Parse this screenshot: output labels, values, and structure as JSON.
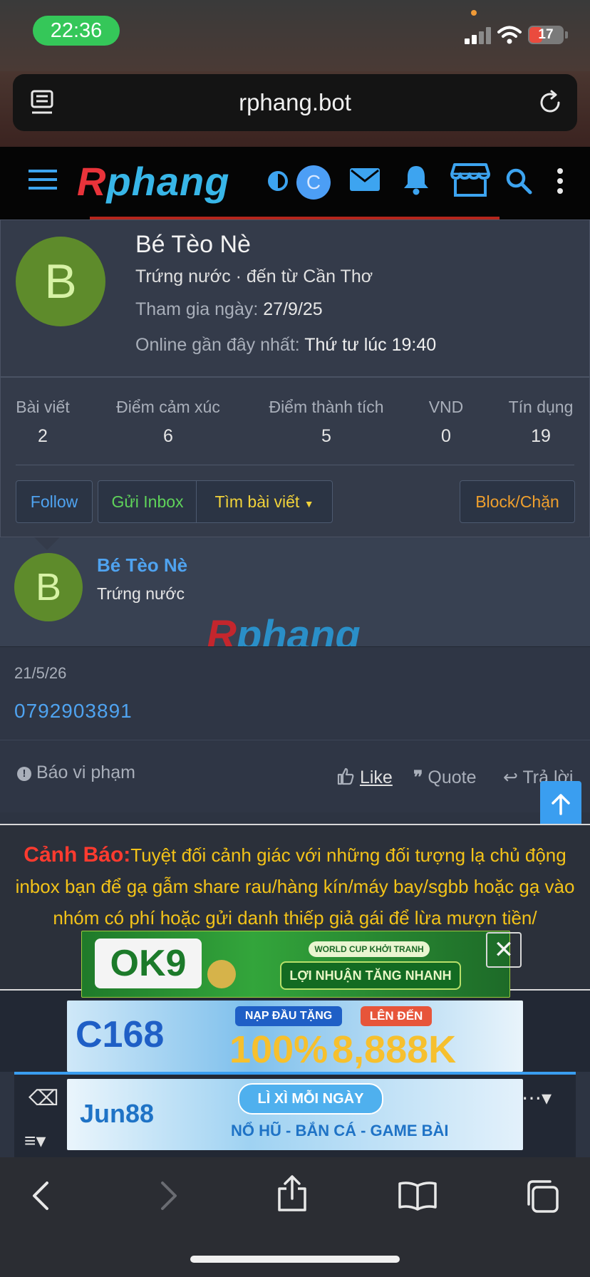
{
  "status_bar": {
    "time": "22:36",
    "battery": "17"
  },
  "browser": {
    "url": "rphang.bot"
  },
  "site": {
    "logo_r": "R",
    "logo_rest": "phang",
    "avatar_letter": "C"
  },
  "profile": {
    "avatar_letter": "B",
    "name": "Bé Tèo Nè",
    "subtitle": "Trứng nước · đến từ Cần Thơ",
    "joined_label": "Tham gia ngày:",
    "joined_value": "27/9/25",
    "online_label": "Online gần đây nhất:",
    "online_value": "Thứ tư lúc 19:40",
    "stats": [
      {
        "label": "Bài viết",
        "value": "2"
      },
      {
        "label": "Điểm cảm xúc",
        "value": "6"
      },
      {
        "label": "Điểm thành tích",
        "value": "5"
      },
      {
        "label": "VND",
        "value": "0"
      },
      {
        "label": "Tín dụng",
        "value": "19"
      }
    ],
    "buttons": {
      "follow": "Follow",
      "inbox": "Gửi Inbox",
      "find_posts": "Tìm bài viết",
      "block": "Block/Chặn"
    },
    "colors": {
      "follow": "#4fa3f0",
      "inbox": "#5fd35a",
      "find_posts": "#f2d33a",
      "block": "#f0a02d"
    }
  },
  "post": {
    "avatar_letter": "B",
    "author": "Bé Tèo Nè",
    "author_title": "Trứng nước",
    "date": "21/5/26",
    "content": "0792903891",
    "actions": {
      "report": "Báo vi phạm",
      "like": "Like",
      "quote": "Quote",
      "reply": "Trả lời"
    }
  },
  "warning": {
    "label": "Cảnh Báo:",
    "text": "Tuyệt đối cảnh giác với những đối tượng lạ chủ động inbox bạn để gạ gẫm share rau/hàng kín/máy bay/sgbb hoặc gạ vào nhóm có phí hoặc gửi danh thiếp giả gái để lừa mượn tiền/"
  },
  "ads": {
    "ok9": {
      "brand": "OK9",
      "badge": "WORLD CUP KHỞI TRANH",
      "slogan": "LỢI NHUẬN TĂNG NHANH"
    },
    "c168": {
      "brand": "C168",
      "promo_top": "NẠP ĐẦU TẶNG",
      "percent": "100%",
      "upto": "LÊN ĐẾN",
      "amount": "8,888K"
    },
    "jun88": {
      "brand": "Jun88",
      "promo_top": "LÌ XÌ MỖI NGÀY",
      "promo_bottom": "NỔ HŨ - BẮN CÁ - GAME BÀI"
    }
  },
  "icons": [
    "menu-icon",
    "contrast-icon",
    "mail-icon",
    "bell-icon",
    "store-icon",
    "search-icon",
    "more-vertical-icon",
    "arrow-up-icon",
    "arrow-down-icon",
    "back-icon",
    "forward-icon",
    "share-icon",
    "bookmarks-icon",
    "tabs-icon"
  ]
}
